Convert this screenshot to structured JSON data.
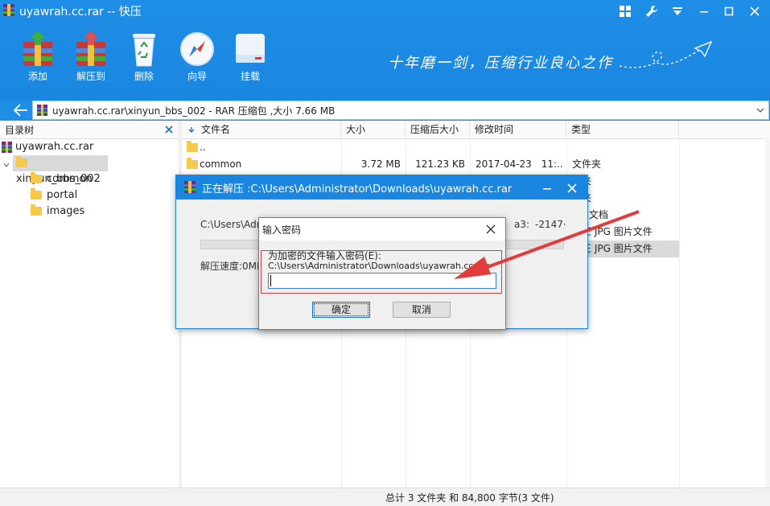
{
  "window": {
    "title": "uyawrah.cc.rar -- 快压"
  },
  "toolbar": {
    "add": "添加",
    "extract_to": "解压到",
    "delete": "删除",
    "wizard": "向导",
    "mount": "挂载"
  },
  "slogan": "十年磨一剑，压缩行业良心之作",
  "address": {
    "path": "uyawrah.cc.rar\\xinyun_bbs_002 - RAR 压缩包 ,大小 7.66 MB"
  },
  "tree": {
    "header": "目录树",
    "root": "uyawrah.cc.rar",
    "selected": "xinyun_bbs_002",
    "children": [
      "common",
      "portal",
      "images"
    ]
  },
  "list": {
    "columns": [
      "文件名",
      "大小",
      "压缩后大小",
      "修改时间",
      "类型"
    ],
    "rows": [
      {
        "name": "..",
        "size": "",
        "packed": "",
        "modified": "",
        "type": ""
      },
      {
        "name": "common",
        "size": "3.72 MB",
        "packed": "121.23 KB",
        "modified": "2017-04-23　11:...",
        "type": "文件夹"
      },
      {
        "name": "",
        "size": "",
        "packed": "",
        "modified": "",
        "type": "件夹"
      },
      {
        "name": "",
        "size": "",
        "packed": "",
        "modified": "",
        "type": "件夹"
      },
      {
        "name": "",
        "size": "",
        "packed": "",
        "modified": "",
        "type": "ML 文档"
      },
      {
        "name": "",
        "size": "",
        "packed": "",
        "modified": "",
        "type": "图王 JPG 图片文件"
      },
      {
        "name": "",
        "size": "",
        "packed": "",
        "modified": "",
        "type": "图王 JPG 图片文件"
      }
    ]
  },
  "status": {
    "text": "总计 3 文件夹  和  84,800 字节(3 文件)"
  },
  "extract_dialog": {
    "title": "正在解压 :C:\\Users\\Administrator\\Downloads\\uyawrah.cc.rar",
    "current_file_partial": "C:\\Users\\Adı",
    "right_fragment_a": "a3:",
    "right_fragment_b": "-2147·",
    "speed_label": "解压速度:0MI"
  },
  "password_dialog": {
    "title": "输入密码",
    "prompt": "为加密的文件输入密码(E):",
    "archive_path": "C:\\Users\\Administrator\\Downloads\\uyawrah.cc.rar",
    "password_value": "",
    "ok": "确定",
    "cancel": "取消"
  },
  "colors": {
    "accent": "#1a86e0",
    "annotation_red": "#e23b3b"
  }
}
